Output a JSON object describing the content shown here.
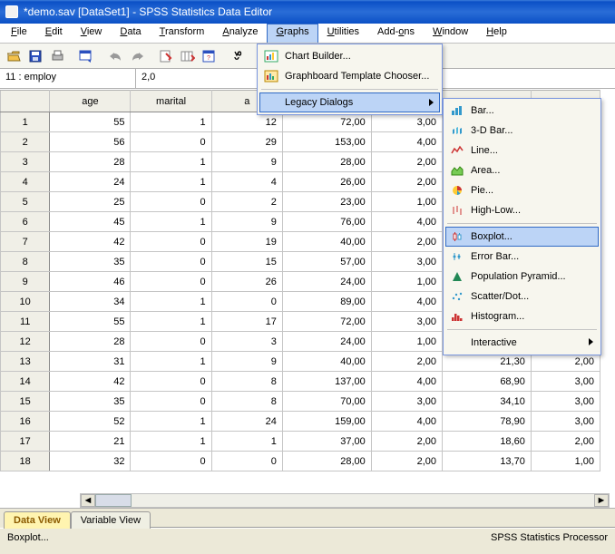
{
  "window": {
    "title": "*demo.sav [DataSet1] - SPSS Statistics Data Editor"
  },
  "menubar": {
    "file": "File",
    "edit": "Edit",
    "view": "View",
    "data": "Data",
    "transform": "Transform",
    "analyze": "Analyze",
    "graphs": "Graphs",
    "utilities": "Utilities",
    "addons": "Add-ons",
    "window": "Window",
    "help": "Help"
  },
  "graphs_menu": {
    "chart_builder": "Chart Builder...",
    "graphboard": "Graphboard Template Chooser...",
    "legacy": "Legacy Dialogs"
  },
  "legacy_menu": {
    "bar": "Bar...",
    "bar3d": "3-D Bar...",
    "line": "Line...",
    "area": "Area...",
    "pie": "Pie...",
    "highlow": "High-Low...",
    "boxplot": "Boxplot...",
    "errorbar": "Error Bar...",
    "poppyr": "Population Pyramid...",
    "scatter": "Scatter/Dot...",
    "histogram": "Histogram...",
    "interactive": "Interactive"
  },
  "cellref": {
    "name": "11 : employ",
    "value": "2,0"
  },
  "columns": [
    "age",
    "marital",
    "a"
  ],
  "rows": [
    {
      "n": 1,
      "age": 55,
      "marital": 1,
      "a": 12,
      "c5": "72,00",
      "c6": "3,00",
      "c7": "",
      "c8": ""
    },
    {
      "n": 2,
      "age": 56,
      "marital": 0,
      "a": 29,
      "c5": "153,00",
      "c6": "4,00",
      "c7": "",
      "c8": ""
    },
    {
      "n": 3,
      "age": 28,
      "marital": 1,
      "a": 9,
      "c5": "28,00",
      "c6": "2,00",
      "c7": "",
      "c8": ""
    },
    {
      "n": 4,
      "age": 24,
      "marital": 1,
      "a": 4,
      "c5": "26,00",
      "c6": "2,00",
      "c7": "",
      "c8": ""
    },
    {
      "n": 5,
      "age": 25,
      "marital": 0,
      "a": 2,
      "c5": "23,00",
      "c6": "1,00",
      "c7": "",
      "c8": ""
    },
    {
      "n": 6,
      "age": 45,
      "marital": 1,
      "a": 9,
      "c5": "76,00",
      "c6": "4,00",
      "c7": "",
      "c8": ""
    },
    {
      "n": 7,
      "age": 42,
      "marital": 0,
      "a": 19,
      "c5": "40,00",
      "c6": "2,00",
      "c7": "",
      "c8": ""
    },
    {
      "n": 8,
      "age": 35,
      "marital": 0,
      "a": 15,
      "c5": "57,00",
      "c6": "3,00",
      "c7": "",
      "c8": ""
    },
    {
      "n": 9,
      "age": 46,
      "marital": 0,
      "a": 26,
      "c5": "24,00",
      "c6": "1,00",
      "c7": "",
      "c8": ""
    },
    {
      "n": 10,
      "age": 34,
      "marital": 1,
      "a": 0,
      "c5": "89,00",
      "c6": "4,00",
      "c7": "",
      "c8": ""
    },
    {
      "n": 11,
      "age": 55,
      "marital": 1,
      "a": 17,
      "c5": "72,00",
      "c6": "3,00",
      "c7": "",
      "c8": ""
    },
    {
      "n": 12,
      "age": 28,
      "marital": 0,
      "a": 3,
      "c5": "24,00",
      "c6": "1,00",
      "c7": "",
      "c8": ""
    },
    {
      "n": 13,
      "age": 31,
      "marital": 1,
      "a": 9,
      "c5": "40,00",
      "c6": "2,00",
      "c7": "21,30",
      "c8": "2,00"
    },
    {
      "n": 14,
      "age": 42,
      "marital": 0,
      "a": 8,
      "c5": "137,00",
      "c6": "4,00",
      "c7": "68,90",
      "c8": "3,00"
    },
    {
      "n": 15,
      "age": 35,
      "marital": 0,
      "a": 8,
      "c5": "70,00",
      "c6": "3,00",
      "c7": "34,10",
      "c8": "3,00"
    },
    {
      "n": 16,
      "age": 52,
      "marital": 1,
      "a": 24,
      "c5": "159,00",
      "c6": "4,00",
      "c7": "78,90",
      "c8": "3,00"
    },
    {
      "n": 17,
      "age": 21,
      "marital": 1,
      "a": 1,
      "c5": "37,00",
      "c6": "2,00",
      "c7": "18,60",
      "c8": "2,00"
    },
    {
      "n": 18,
      "age": 32,
      "marital": 0,
      "a": 0,
      "c5": "28,00",
      "c6": "2,00",
      "c7": "13,70",
      "c8": "1,00"
    }
  ],
  "tabs": {
    "data_view": "Data View",
    "variable_view": "Variable View"
  },
  "status": {
    "left": "Boxplot...",
    "right": "SPSS Statistics Processor"
  }
}
